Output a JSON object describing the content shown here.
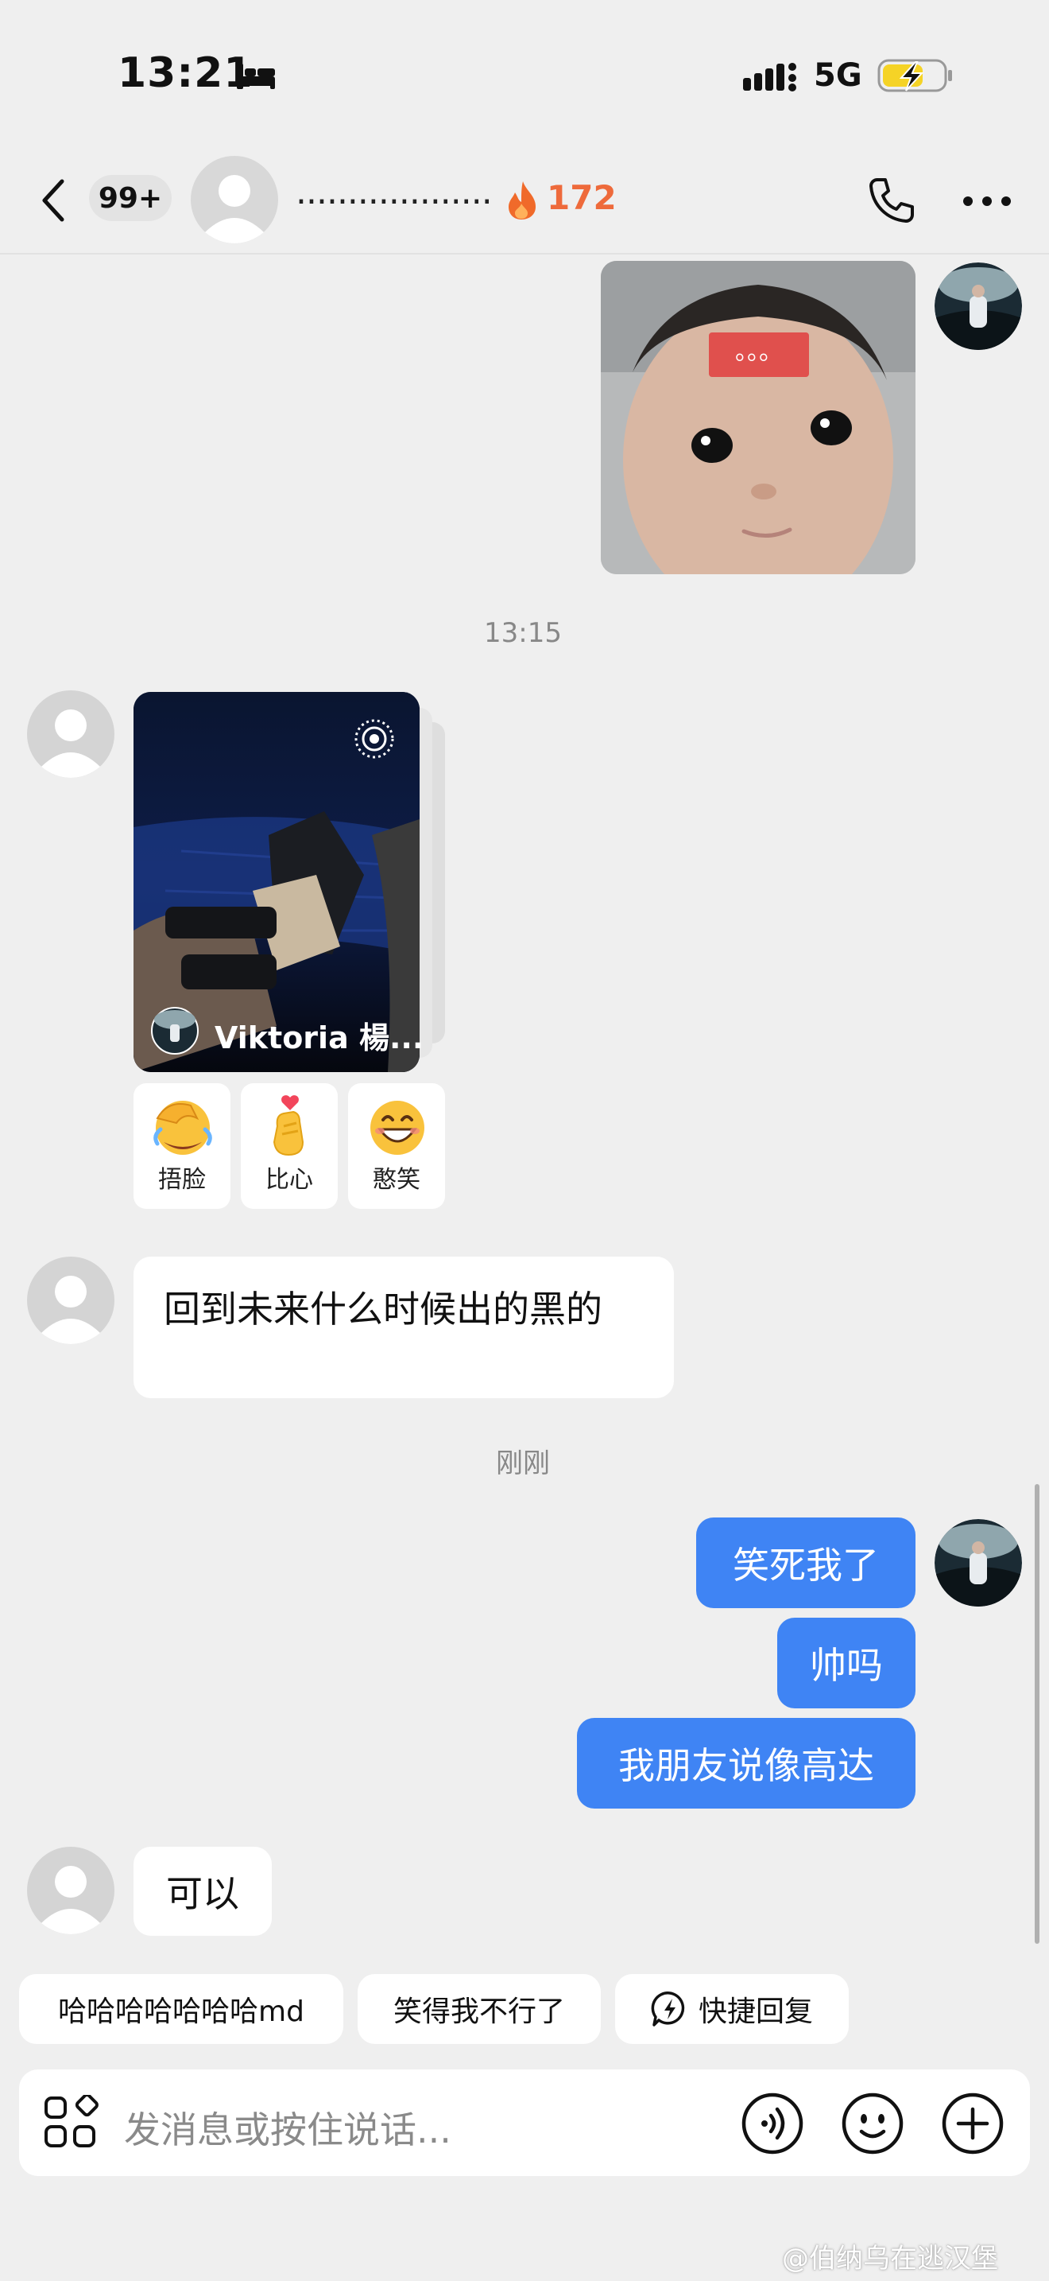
{
  "status_bar": {
    "time": "13:21",
    "network": "5G"
  },
  "header": {
    "unread_count": "99+",
    "contact_name": "...................",
    "streak": "172"
  },
  "messages": {
    "image_sticker_dots": "。。。",
    "time_1": "13:15",
    "story_author": "Viktoria 楊...",
    "reactions": [
      {
        "label": "捂脸"
      },
      {
        "label": "比心"
      },
      {
        "label": "憨笑"
      }
    ],
    "incoming_1": "回到未来什么时候出的黑的",
    "time_2": "刚刚",
    "outgoing": [
      "笑死我了",
      "帅吗",
      "我朋友说像高达"
    ],
    "incoming_2": "可以"
  },
  "quick_replies": [
    "哈哈哈哈哈哈哈md",
    "笑得我不行了",
    "快捷回复"
  ],
  "input": {
    "placeholder": "发消息或按住说话..."
  },
  "watermark": "@伯纳乌在逃汉堡",
  "colors": {
    "accent": "#3f84f4",
    "streak": "#ee6a3b",
    "background": "#efefef"
  }
}
